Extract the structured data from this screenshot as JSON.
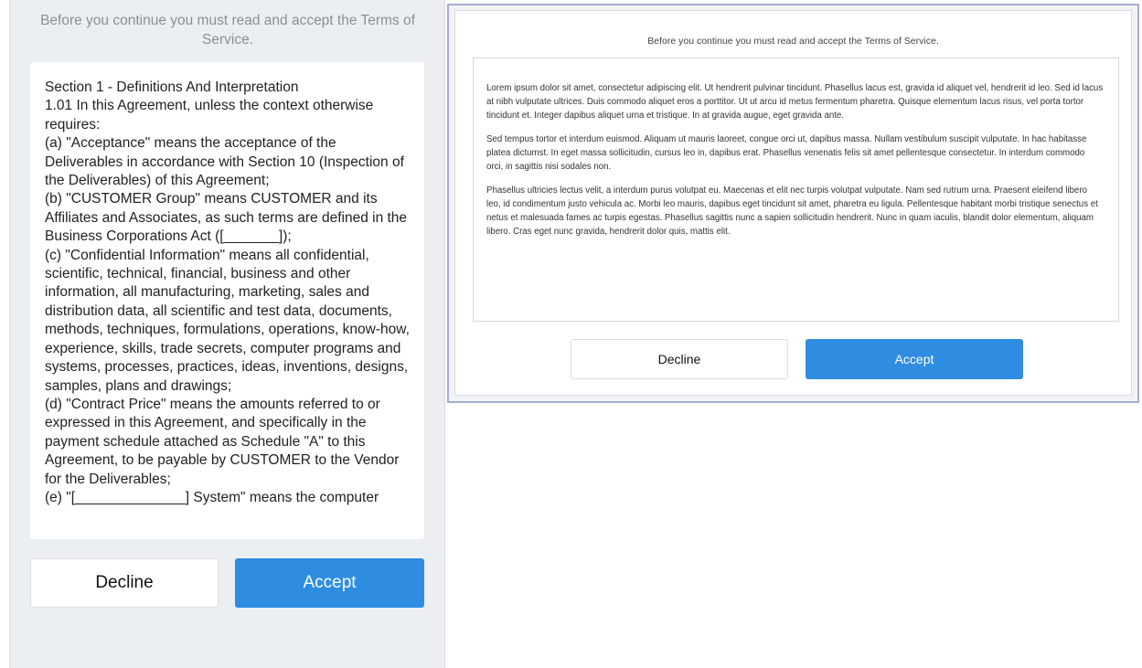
{
  "mobile": {
    "intro": "Before you continue you must read and accept the Terms of Service.",
    "terms_text": "Section 1 - Definitions And Interpretation\n1.01 In this Agreement, unless the context otherwise requires:\n(a) \"Acceptance\" means the acceptance of the Deliverables in accordance with Section 10 (Inspection of the Deliverables) of this Agreement;\n(b) \"CUSTOMER Group\" means CUSTOMER and its Affiliates and Associates, as such terms are defined in the Business Corporations Act ([_______]);\n(c) \"Confidential Information\" means all confidential, scientific, technical, financial, business and other information, all manufacturing, marketing, sales and distribution data, all scientific and test data, documents, methods, techniques, formulations, operations, know-how, experience, skills, trade secrets, computer programs and systems, processes, practices, ideas, inventions, designs, samples, plans and drawings;\n(d) \"Contract Price\" means the amounts referred to or expressed in this Agreement, and specifically in the payment schedule attached as Schedule \"A\" to this Agreement, to be payable by CUSTOMER to the Vendor for the Deliverables;\n(e) \"[______________] System\" means the computer",
    "decline_label": "Decline",
    "accept_label": "Accept"
  },
  "desktop": {
    "intro": "Before you continue you must read and accept the Terms of Service.",
    "paragraphs": [
      "Lorem ipsum dolor sit amet, consectetur adipiscing elit. Ut hendrerit pulvinar tincidunt. Phasellus lacus est, gravida id aliquet vel, hendrerit id leo. Sed id lacus at nibh vulputate ultrices. Duis commodo aliquet eros a porttitor. Ut ut arcu id metus fermentum pharetra. Quisque elementum lacus risus, vel porta tortor tincidunt et. Integer dapibus aliquet urna et tristique. In at gravida augue, eget gravida ante.",
      "Sed tempus tortor et interdum euismod. Aliquam ut mauris laoreet, congue orci ut, dapibus massa. Nullam vestibulum suscipit vulputate. In hac habitasse platea dictumst. In eget massa sollicitudin, cursus leo in, dapibus erat. Phasellus venenatis felis sit amet pellentesque consectetur. In interdum commodo orci, in sagittis nisi sodales non.",
      "Phasellus ultricies lectus velit, a interdum purus volutpat eu. Maecenas et elit nec turpis volutpat vulputate. Nam sed rutrum urna. Praesent eleifend libero leo, id condimentum justo vehicula ac. Morbi leo mauris, dapibus eget tincidunt sit amet, pharetra eu ligula. Pellentesque habitant morbi tristique senectus et netus et malesuada fames ac turpis egestas. Phasellus sagittis nunc a sapien sollicitudin hendrerit. Nunc in quam iaculis, blandit dolor elementum, aliquam libero. Cras eget nunc gravida, hendrerit dolor quis, mattis elit."
    ],
    "decline_label": "Decline",
    "accept_label": "Accept"
  },
  "colors": {
    "accent": "#2e8de0",
    "left_background": "#eceff2",
    "dialog_border": "#a9acd0"
  }
}
